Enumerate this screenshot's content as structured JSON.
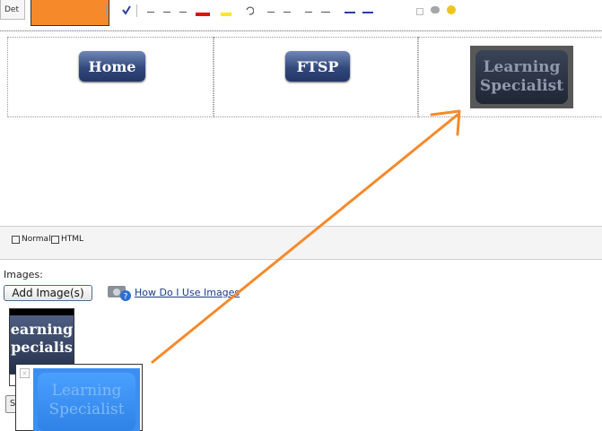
{
  "toolbar": {
    "format_label": "Det"
  },
  "editor": {
    "buttons": {
      "home": "Home",
      "ftsp": "FTSP",
      "learning_line1": "Learning",
      "learning_line2": "Specialist"
    }
  },
  "modes": {
    "normal": "Normal",
    "html": "HTML"
  },
  "images": {
    "label": "Images:",
    "add_button": "Add Image(s)",
    "help_link": "How Do I Use Images",
    "thumb_line1": "earning",
    "thumb_line2": "pecialis",
    "drag_line1": "Learning",
    "drag_line2": "Specialist"
  },
  "colors": {
    "annotation": "#f68a2b",
    "drag_blue": "#3b8ff0"
  }
}
